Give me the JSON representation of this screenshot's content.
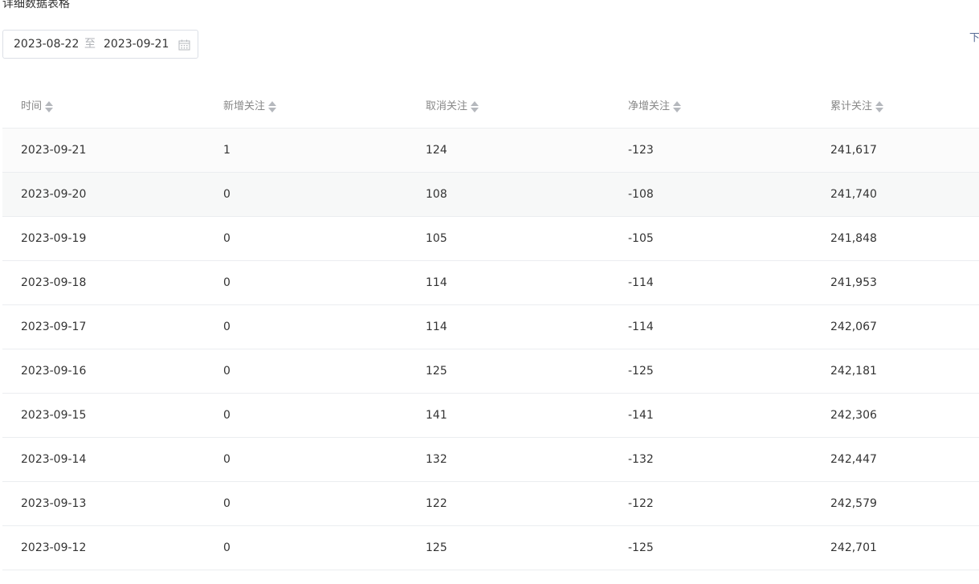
{
  "section": {
    "title": "详细数据表格"
  },
  "date_range": {
    "start": "2023-08-22",
    "separator": "至",
    "end": "2023-09-21"
  },
  "download": {
    "label": "下"
  },
  "table": {
    "columns": [
      "时间",
      "新增关注",
      "取消关注",
      "净增关注",
      "累计关注"
    ],
    "rows": [
      [
        "2023-09-21",
        "1",
        "124",
        "-123",
        "241,617"
      ],
      [
        "2023-09-20",
        "0",
        "108",
        "-108",
        "241,740"
      ],
      [
        "2023-09-19",
        "0",
        "105",
        "-105",
        "241,848"
      ],
      [
        "2023-09-18",
        "0",
        "114",
        "-114",
        "241,953"
      ],
      [
        "2023-09-17",
        "0",
        "114",
        "-114",
        "242,067"
      ],
      [
        "2023-09-16",
        "0",
        "125",
        "-125",
        "242,181"
      ],
      [
        "2023-09-15",
        "0",
        "141",
        "-141",
        "242,306"
      ],
      [
        "2023-09-14",
        "0",
        "132",
        "-132",
        "242,447"
      ],
      [
        "2023-09-13",
        "0",
        "122",
        "-122",
        "242,579"
      ],
      [
        "2023-09-12",
        "0",
        "125",
        "-125",
        "242,701"
      ]
    ]
  },
  "colors": {
    "text": "#333333",
    "header_text": "#888888",
    "border": "#ebedf0",
    "link": "#576b95",
    "hover_row": "#f7f8f8"
  },
  "icons": {
    "calendar": "calendar-icon",
    "sort": "sort-icon"
  }
}
